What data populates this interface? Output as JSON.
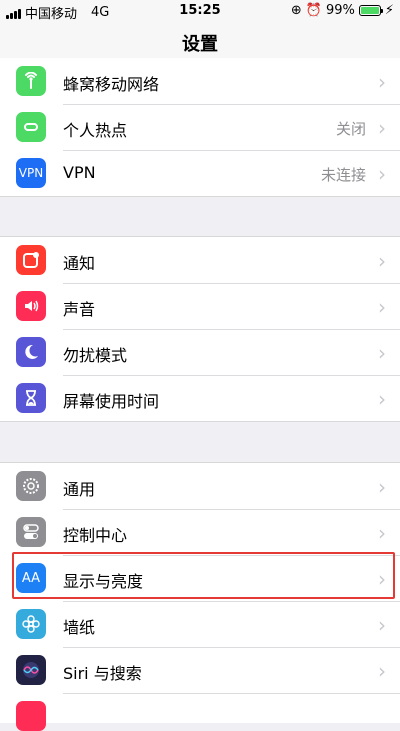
{
  "status_bar": {
    "carrier": "中国移动",
    "network": "4G",
    "time": "15:25",
    "battery": "99%",
    "battery_level": 0.99,
    "battery_color": "#4cd964"
  },
  "nav": {
    "title": "设置"
  },
  "groups": [
    {
      "rows": [
        {
          "label": "蜂窝移动网络",
          "value": "",
          "icon": "cellular-icon",
          "color": "#4cd964"
        },
        {
          "label": "个人热点",
          "value": "关闭",
          "icon": "hotspot-icon",
          "color": "#4cd964"
        },
        {
          "label": "VPN",
          "value": "未连接",
          "icon": "vpn-icon",
          "icon_text": "VPN",
          "color": "#1e6ef5"
        }
      ]
    },
    {
      "rows": [
        {
          "label": "通知",
          "icon": "notification-icon",
          "color": "#ff3b30"
        },
        {
          "label": "声音",
          "icon": "sound-icon",
          "color": "#ff2d55"
        },
        {
          "label": "勿扰模式",
          "icon": "moon-icon",
          "color": "#5856d6"
        },
        {
          "label": "屏幕使用时间",
          "icon": "hourglass-icon",
          "color": "#5856d6"
        }
      ]
    },
    {
      "rows": [
        {
          "label": "通用",
          "icon": "gear-icon",
          "color": "#8e8e93"
        },
        {
          "label": "控制中心",
          "icon": "toggle-icon",
          "color": "#8e8e93"
        },
        {
          "label": "显示与亮度",
          "icon": "display-icon",
          "icon_text": "AA",
          "color": "#1e80f5"
        },
        {
          "label": "墙纸",
          "icon": "wallpaper-icon",
          "color": "#35aadc"
        },
        {
          "label": "Siri 与搜索",
          "icon": "siri-icon",
          "color": "#222244"
        }
      ]
    }
  ],
  "highlight_color": "#e53935"
}
